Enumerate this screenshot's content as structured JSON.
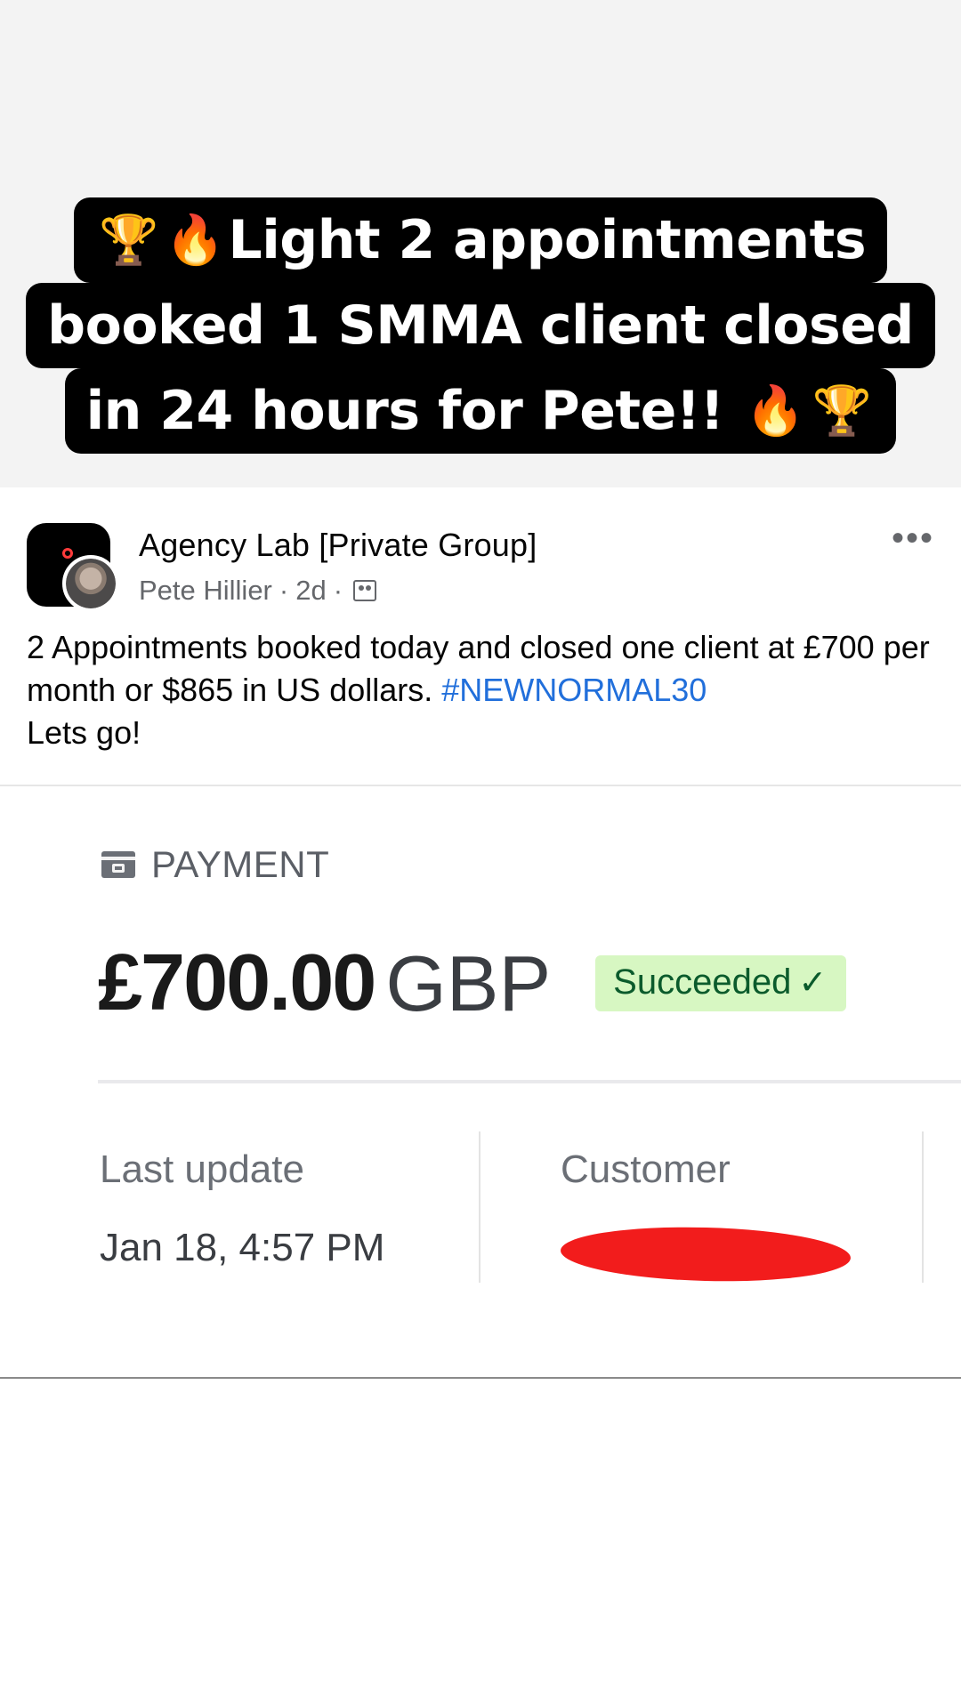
{
  "caption": {
    "line1": "Light 2 appointments",
    "line2": "booked 1 SMMA client closed",
    "line3": "in 24 hours for Pete!!",
    "emoji_trophy": "🏆",
    "emoji_fire": "🔥"
  },
  "post": {
    "group_name": "Agency Lab [Private Group]",
    "author": "Pete Hillier",
    "separator": "·",
    "time": "2d",
    "more_label": "•••",
    "body_text": "2 Appointments booked today and closed one client at £700 per month or $865 in US dollars. ",
    "hashtag": "#NEWNORMAL30",
    "body_end": "Lets go!"
  },
  "payment": {
    "section_label": "PAYMENT",
    "amount": "£700.00",
    "currency": "GBP",
    "status": "Succeeded",
    "status_check": "✓",
    "last_update_label": "Last update",
    "last_update_value": "Jan 18, 4:57 PM",
    "customer_label": "Customer",
    "status_color": "#d7f7c2"
  },
  "colors": {
    "hashtag": "#216fdb",
    "redaction": "#f21c1c",
    "caption_bg": "#000000"
  },
  "icons": [
    "trophy-icon",
    "fire-icon",
    "group-audience-icon",
    "card-icon",
    "check-icon",
    "more-icon"
  ]
}
